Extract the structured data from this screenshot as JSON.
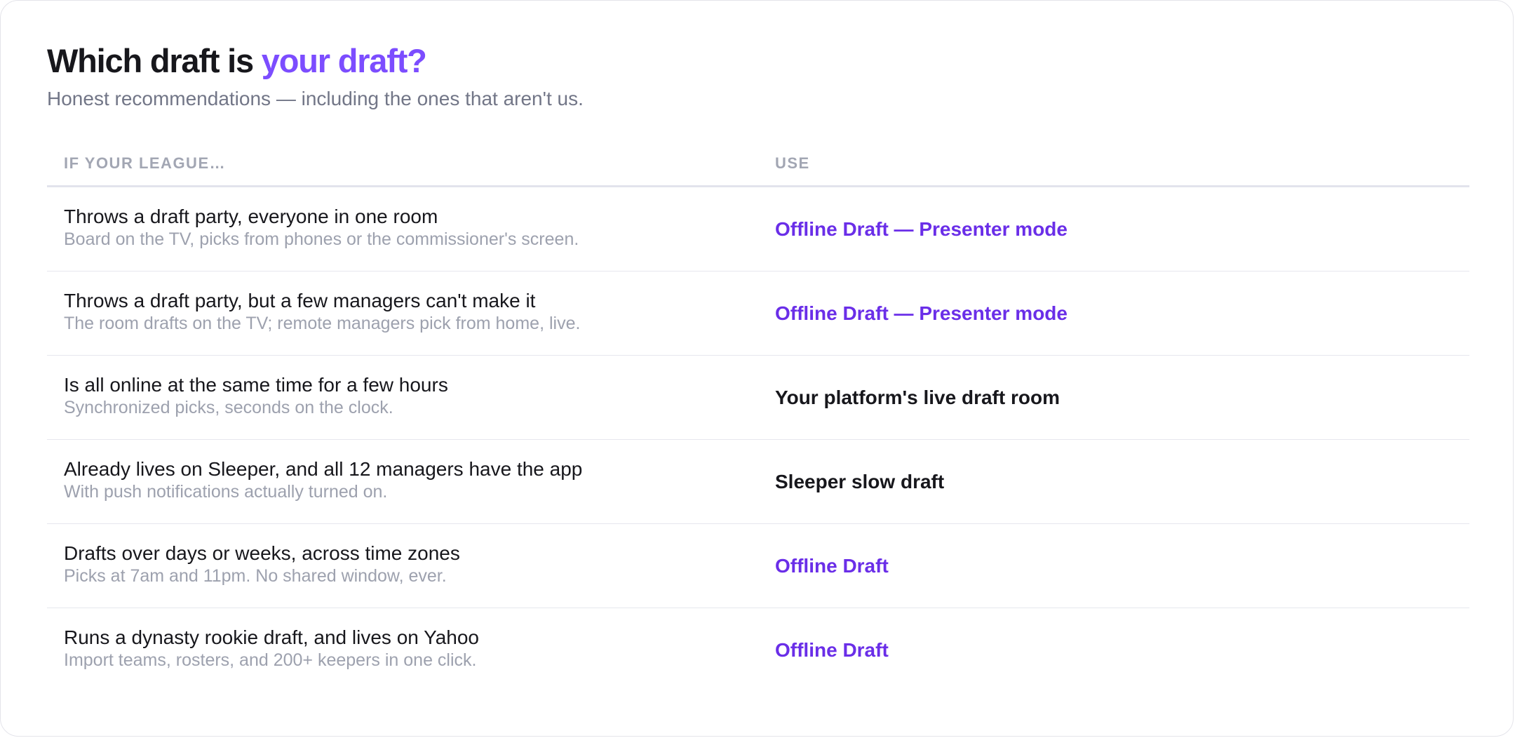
{
  "header": {
    "title_prefix": "Which draft is ",
    "title_accent": "your draft?",
    "subtitle": "Honest recommendations — including the ones that aren't us."
  },
  "table": {
    "columns": [
      "IF YOUR LEAGUE…",
      "USE"
    ],
    "rows": [
      {
        "title": "Throws a draft party, everyone in one room",
        "detail": "Board on the TV, picks from phones or the commissioner's screen.",
        "recommendation": "Offline Draft — Presenter mode",
        "is_link": true
      },
      {
        "title": "Throws a draft party, but a few managers can't make it",
        "detail": "The room drafts on the TV; remote managers pick from home, live.",
        "recommendation": "Offline Draft — Presenter mode",
        "is_link": true
      },
      {
        "title": "Is all online at the same time for a few hours",
        "detail": "Synchronized picks, seconds on the clock.",
        "recommendation": "Your platform's live draft room",
        "is_link": false
      },
      {
        "title": "Already lives on Sleeper, and all 12 managers have the app",
        "detail": "With push notifications actually turned on.",
        "recommendation": "Sleeper slow draft",
        "is_link": false
      },
      {
        "title": "Drafts over days or weeks, across time zones",
        "detail": "Picks at 7am and 11pm. No shared window, ever.",
        "recommendation": "Offline Draft",
        "is_link": true
      },
      {
        "title": "Runs a dynasty rookie draft, and lives on Yahoo",
        "detail": "Import teams, rosters, and 200+ keepers in one click.",
        "recommendation": "Offline Draft",
        "is_link": true
      }
    ]
  },
  "colors": {
    "accent": "#7c4dff",
    "link": "#6a2ee8",
    "text": "#17171c",
    "muted": "#9da1ae"
  }
}
